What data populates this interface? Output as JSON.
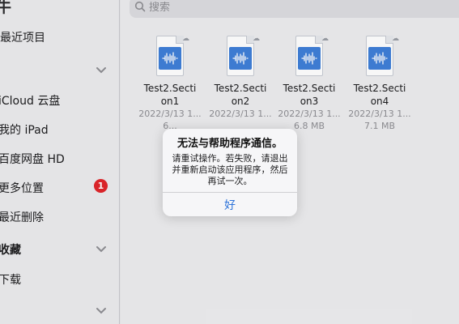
{
  "sidebar": {
    "title": "牛",
    "items": [
      {
        "label": "最近项目"
      },
      {
        "label": "iCloud 云盘"
      },
      {
        "label": "我的 iPad"
      },
      {
        "label": "百度网盘 HD"
      },
      {
        "label": "更多位置",
        "badge": "1"
      },
      {
        "label": "最近删除"
      }
    ],
    "favorites_header": "收藏",
    "favorites": [
      {
        "label": "下载"
      }
    ]
  },
  "search": {
    "placeholder": "搜索"
  },
  "files": [
    {
      "name_line1": "Test2.Secti",
      "name_line2": "on1",
      "date": "2022/3/13 1...",
      "size": "6..."
    },
    {
      "name_line1": "Test2.Secti",
      "name_line2": "on2",
      "date": "2022/3/13 1...",
      "size": ""
    },
    {
      "name_line1": "Test2.Secti",
      "name_line2": "on3",
      "date": "2022/3/13 1...",
      "size": "6.8 MB"
    },
    {
      "name_line1": "Test2.Secti",
      "name_line2": "on4",
      "date": "2022/3/13 1...",
      "size": "7.1 MB"
    }
  ],
  "alert": {
    "title": "无法与帮助程序通信。",
    "message": "请重试操作。若失败，请退出并重新启动该应用程序，然后再试一次。",
    "button": "好"
  },
  "colors": {
    "accent": "#2f74d9",
    "badge": "#e0262b",
    "file_wave": "#3f7fd8"
  },
  "icons": [
    "chevron-down-icon",
    "search-icon",
    "audio-file-icon",
    "cloud-download-icon"
  ]
}
